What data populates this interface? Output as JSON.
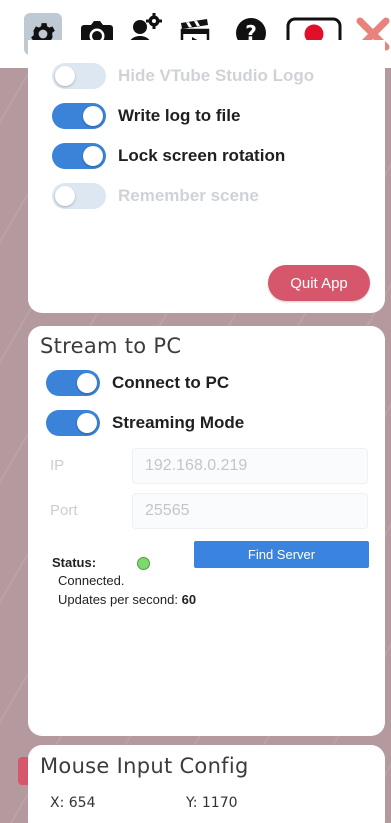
{
  "toolbar": {
    "icons": [
      "gear-icon",
      "camera-icon",
      "model-settings-icon",
      "clapperboard-icon",
      "help-icon",
      "record-icon",
      "close-icon"
    ],
    "close_color": "#e8837b",
    "record_color": "#e0102a"
  },
  "settings": {
    "toggles": [
      {
        "label": "Hide VTube Studio Logo",
        "on": false,
        "enabled": false
      },
      {
        "label": "Write log to file",
        "on": true,
        "enabled": true
      },
      {
        "label": "Lock screen rotation",
        "on": true,
        "enabled": true
      },
      {
        "label": "Remember scene",
        "on": false,
        "enabled": false
      }
    ],
    "quit_label": "Quit App"
  },
  "stream": {
    "title": "Stream to PC",
    "toggles": [
      {
        "label": "Connect to PC",
        "on": true
      },
      {
        "label": "Streaming Mode",
        "on": true
      }
    ],
    "ip_label": "IP",
    "ip_value": "192.168.0.219",
    "port_label": "Port",
    "port_value": "25565",
    "status_label": "Status:",
    "status_text": "Connected.",
    "ups_label": "Updates per second:",
    "ups_value": "60",
    "find_server_label": "Find Server",
    "accent": "#3b82d9"
  },
  "mouse": {
    "title": "Mouse Input Config",
    "x_label": "X:",
    "x_value": "654",
    "y_label": "Y:",
    "y_value": "1170"
  }
}
